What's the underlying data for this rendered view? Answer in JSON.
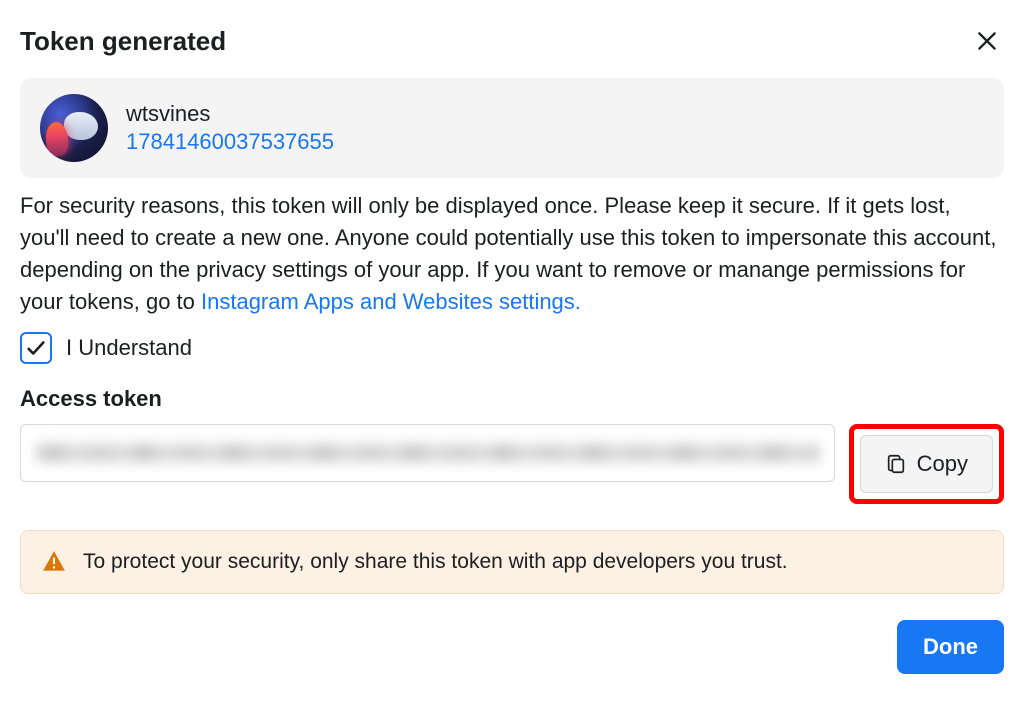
{
  "modal": {
    "title": "Token generated"
  },
  "account": {
    "name": "wtsvines",
    "id": "17841460037537655"
  },
  "body": {
    "text_before_link": "For security reasons, this token will only be displayed once. Please keep it secure. If it gets lost, you'll need to create a new one. Anyone could potentially use this token to impersonate this account, depending on the privacy settings of your app. If you want to remove or manange permissions for your tokens, go to ",
    "link_text": "Instagram Apps and Websites settings."
  },
  "consent": {
    "label": "I Understand",
    "checked": true
  },
  "token": {
    "label": "Access token",
    "copy_label": "Copy"
  },
  "warning": {
    "text": "To protect your security, only share this token with app developers you trust."
  },
  "footer": {
    "done_label": "Done"
  }
}
